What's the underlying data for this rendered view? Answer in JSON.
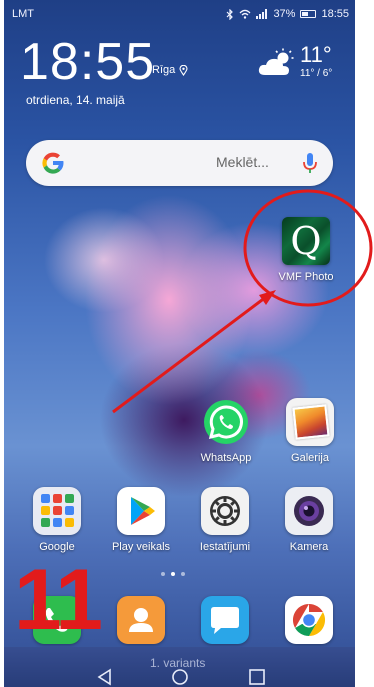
{
  "status_bar": {
    "carrier": "LMT",
    "battery": "37%",
    "time": "18:55"
  },
  "lock_widget": {
    "clock": "18:55",
    "city": "Rīga",
    "date": "otrdiena, 14. maijā"
  },
  "weather": {
    "temp": "11°",
    "range": "11° / 6°",
    "icon": "partly-cloudy-icon"
  },
  "search": {
    "placeholder": "Meklēt..."
  },
  "apps": {
    "vmf": {
      "label": "VMF Photo",
      "glyph": "Q"
    },
    "whatsapp": {
      "label": "WhatsApp"
    },
    "galerija": {
      "label": "Galerija"
    },
    "google": {
      "label": "Google"
    },
    "play": {
      "label": "Play veikals"
    },
    "iestatijumi": {
      "label": "Iestatījumi"
    },
    "kamera": {
      "label": "Kamera"
    }
  },
  "dock": [
    "phone-icon",
    "contacts-icon",
    "messages-icon",
    "chrome-icon"
  ],
  "annotation": {
    "number": "11",
    "variant": "1. variants",
    "color": "#e21b1b"
  },
  "colors": {
    "accent_red": "#e21b1b",
    "whatsapp_green": "#25d366",
    "vmf_green": "#0f6a3a"
  }
}
